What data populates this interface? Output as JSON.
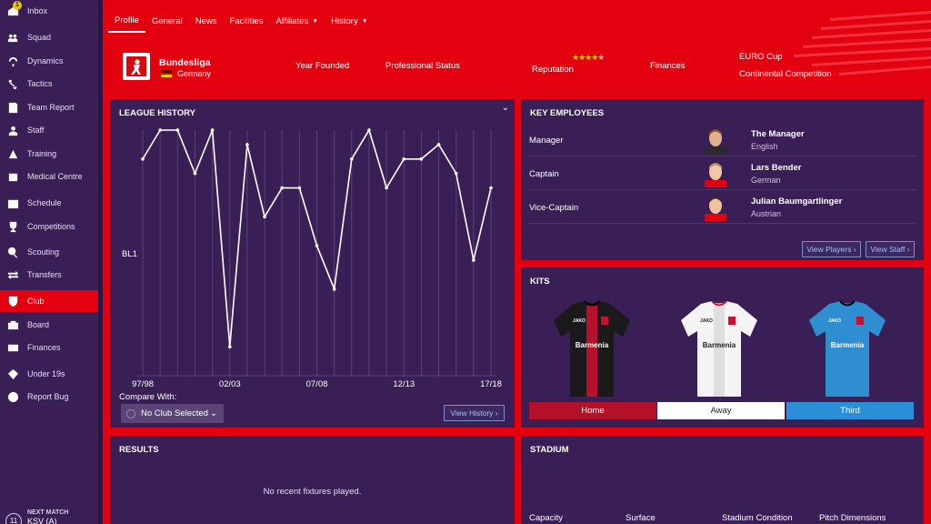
{
  "sidebar": {
    "items": [
      {
        "label": "Inbox",
        "icon": "inbox-icon",
        "badge": "1"
      },
      {
        "label": "Squad",
        "icon": "squad-icon"
      },
      {
        "label": "Dynamics",
        "icon": "dynamics-icon"
      },
      {
        "label": "Tactics",
        "icon": "tactics-icon"
      },
      {
        "label": "Team Report",
        "icon": "team-report-icon"
      },
      {
        "label": "Staff",
        "icon": "staff-icon"
      },
      {
        "label": "Training",
        "icon": "training-icon"
      },
      {
        "label": "Medical Centre",
        "icon": "medical-icon"
      },
      {
        "label": "Schedule",
        "icon": "schedule-icon"
      },
      {
        "label": "Competitions",
        "icon": "trophy-icon"
      },
      {
        "label": "Scouting",
        "icon": "scouting-icon"
      },
      {
        "label": "Transfers",
        "icon": "transfers-icon"
      },
      {
        "label": "Club",
        "icon": "club-icon",
        "active": true
      },
      {
        "label": "Board",
        "icon": "board-icon"
      },
      {
        "label": "Finances",
        "icon": "finances-icon"
      },
      {
        "label": "Under 19s",
        "icon": "under19-icon"
      },
      {
        "label": "Report Bug",
        "icon": "report-bug-icon"
      }
    ],
    "next_match": {
      "label": "NEXT MATCH",
      "opponent": "KSV (A)",
      "day": "11"
    }
  },
  "header": {
    "tabs": [
      "Profile",
      "General",
      "News",
      "Facilities",
      "Affiliates",
      "History"
    ],
    "league": "Bundesliga",
    "country": "Germany",
    "year_founded_label": "Year Founded",
    "professional_status_label": "Professional Status",
    "reputation_label": "Reputation",
    "reputation_stars": 4,
    "reputation_max": 5,
    "finances_label": "Finances",
    "continental_value": "EURO Cup",
    "continental_label": "Continental Competition"
  },
  "league_history": {
    "title": "LEAGUE HISTORY",
    "compare_label": "Compare With:",
    "compare_value": "No Club Selected",
    "view_history": "View History"
  },
  "chart_data": {
    "type": "line",
    "x": [
      "97/98",
      "98/99",
      "99/00",
      "00/01",
      "01/02",
      "02/03",
      "03/04",
      "04/05",
      "05/06",
      "06/07",
      "07/08",
      "08/09",
      "09/10",
      "10/11",
      "11/12",
      "12/13",
      "13/14",
      "14/15",
      "15/16",
      "16/17",
      "17/18"
    ],
    "x_tick_labels": [
      "97/98",
      "02/03",
      "07/08",
      "12/13",
      "17/18"
    ],
    "y_tick_labels": [
      "BL1"
    ],
    "series": [
      {
        "values": [
          3,
          1,
          1,
          4,
          1,
          16,
          2,
          7,
          5,
          5,
          9,
          12,
          3,
          1,
          5,
          3,
          3,
          2,
          4,
          10,
          5
        ]
      }
    ],
    "ylim": [
      1,
      18
    ],
    "y_inverted": true,
    "grid": true
  },
  "employees": {
    "title": "KEY EMPLOYEES",
    "rows": [
      {
        "role": "Manager",
        "name": "The Manager",
        "nationality": "English"
      },
      {
        "role": "Captain",
        "name": "Lars Bender",
        "nationality": "German"
      },
      {
        "role": "Vice-Captain",
        "name": "Julian Baumgartlinger",
        "nationality": "Austrian"
      }
    ],
    "view_players": "View Players",
    "view_staff": "View Staff"
  },
  "kits": {
    "title": "KITS",
    "items": [
      {
        "label": "Home",
        "color": "#b3102a"
      },
      {
        "label": "Away",
        "color": "#ffffff"
      },
      {
        "label": "Third",
        "color": "#2a8fd6"
      }
    ],
    "sponsor": "Barmenia",
    "brand": "JAKO"
  },
  "results": {
    "title": "RESULTS",
    "empty": "No recent fixtures played."
  },
  "stadium": {
    "title": "STADIUM",
    "fields": [
      "Capacity",
      "Surface",
      "Stadium Condition",
      "Pitch Dimensions"
    ]
  },
  "colors": {
    "brand": "#e3000f",
    "panel": "#3a1f57",
    "sidebar": "#3a1f57"
  }
}
